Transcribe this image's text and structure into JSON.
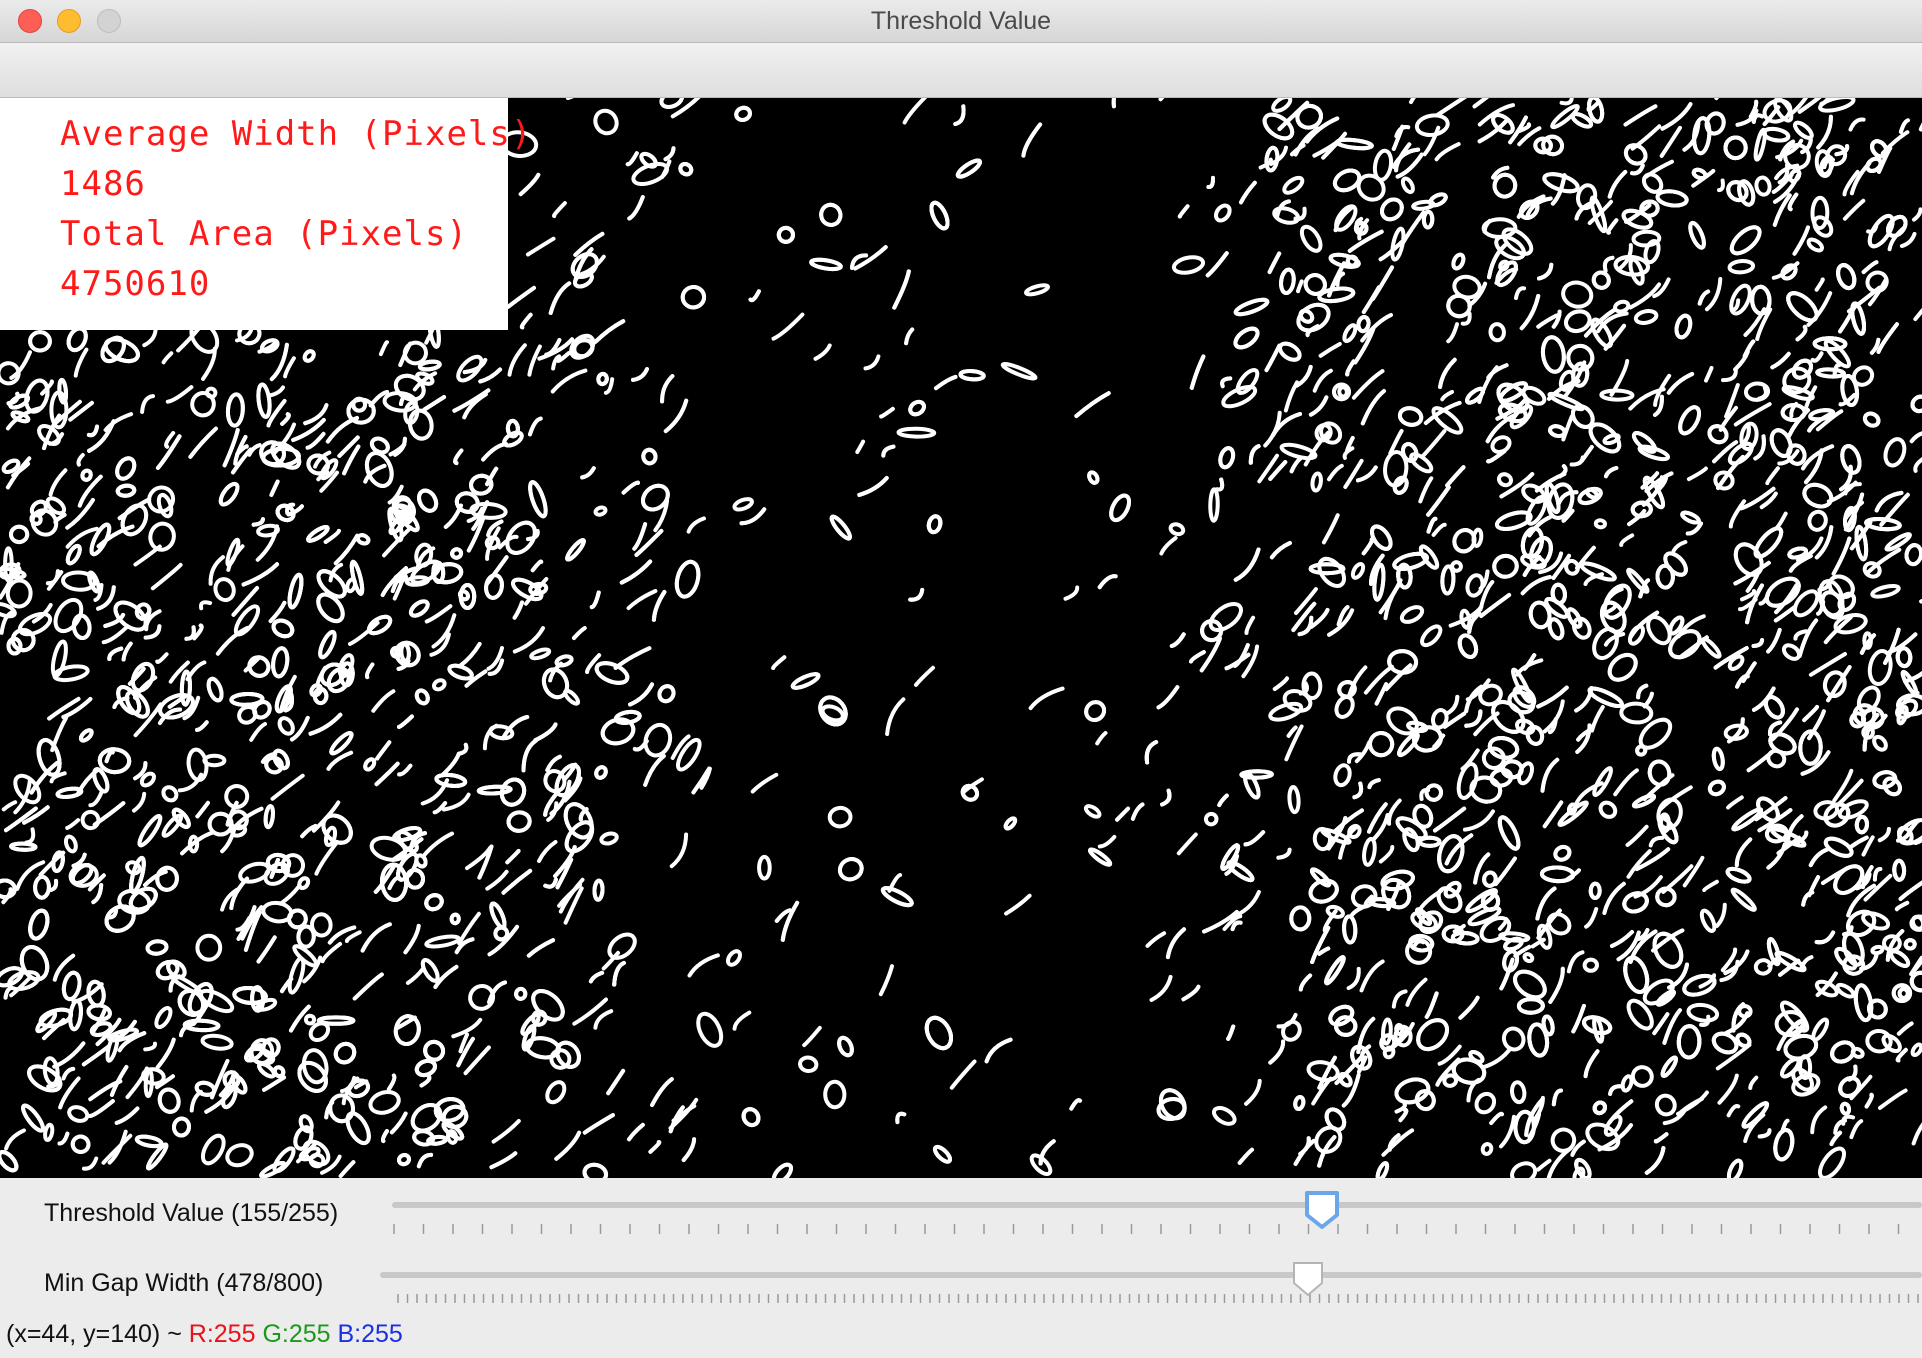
{
  "window": {
    "title": "Threshold Value"
  },
  "overlay": {
    "avg_width_label": "Average Width (Pixels)",
    "avg_width_value": "1486",
    "total_area_label": "Total Area (Pixels)",
    "total_area_value": "4750610",
    "text_color": "#ff1a1a"
  },
  "trackbars": [
    {
      "label": "Threshold Value (155/255)",
      "value": 155,
      "max": 255
    },
    {
      "label": "Min Gap Width (478/800)",
      "value": 478,
      "max": 800
    }
  ],
  "status": {
    "coords": "(x=44, y=140) ~",
    "r": "R:255",
    "g": "G:255",
    "b": "B:255"
  }
}
